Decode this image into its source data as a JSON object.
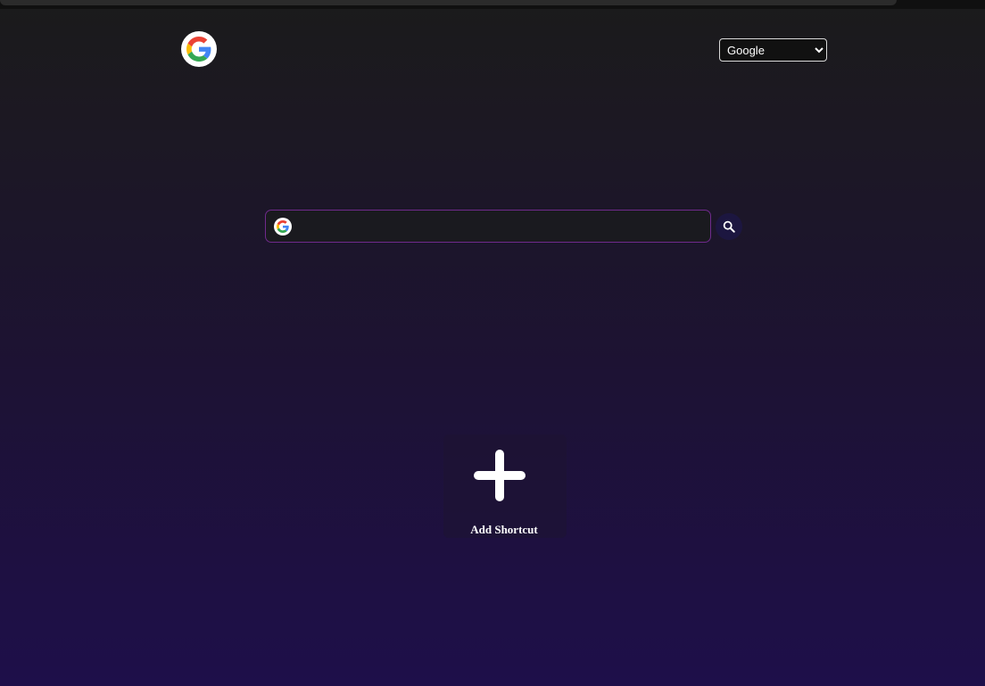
{
  "search_engine": {
    "selected": "Google",
    "options": [
      "Google"
    ]
  },
  "search": {
    "value": "",
    "placeholder": ""
  },
  "shortcuts": {
    "add_label": "Add Shortcut"
  },
  "icons": {
    "logo": "google-g-icon",
    "search_engine_icon": "google-g-icon",
    "search_button": "magnifier-icon",
    "add_shortcut": "plus-icon"
  },
  "colors": {
    "background_top": "#1b1b1b",
    "background_bottom": "#1e0f4a",
    "search_border": "#6f2a8c",
    "search_button_bg": "#1c1640",
    "text": "#ffffff"
  }
}
